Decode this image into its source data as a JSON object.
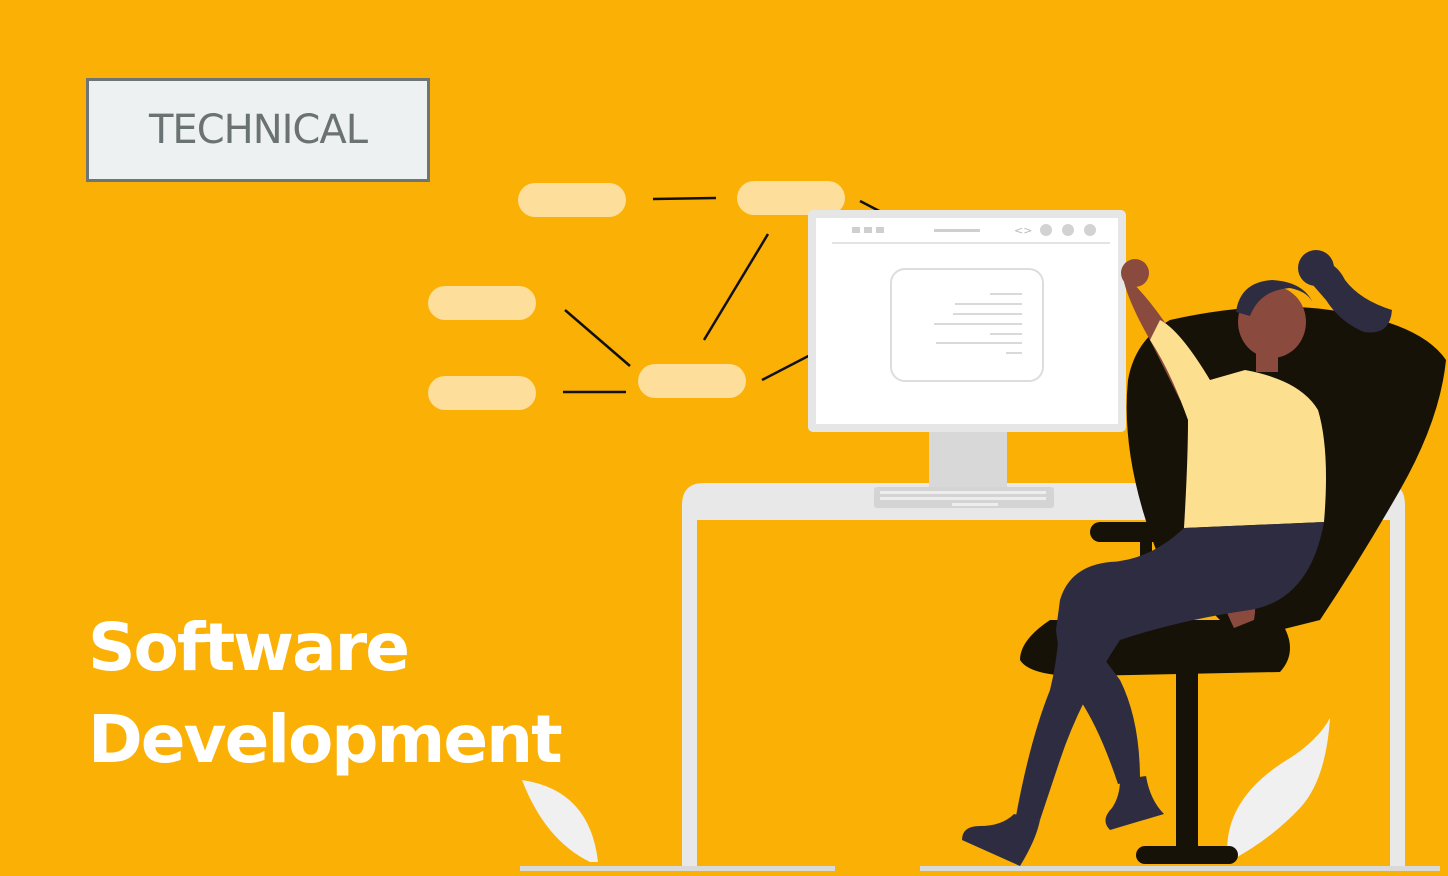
{
  "tag": {
    "label": "TECHNICAL"
  },
  "title": {
    "line1": "Software",
    "line2": "Development"
  },
  "colors": {
    "background": "#FAB005",
    "tag_bg": "#EEF1F1",
    "tag_border": "#6E7577",
    "title": "#FFFFFF",
    "pill": "#FDDE9A",
    "chair": "#161208",
    "shirt": "#FDE08F",
    "pants": "#2E2C40"
  },
  "icons": [
    "flowchart-nodes",
    "monitor-icon",
    "keyboard-icon",
    "desk",
    "office-chair",
    "person-illustration",
    "plant-leaf"
  ]
}
